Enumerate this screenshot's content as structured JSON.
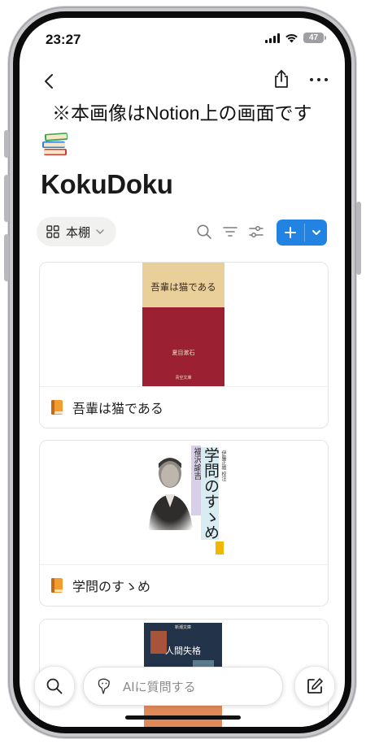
{
  "status_bar": {
    "time": "23:27",
    "battery": "47"
  },
  "page": {
    "note": "※本画像はNotion上の画面です",
    "title": "KokuDoku",
    "icon": "books-emoji"
  },
  "toolbar": {
    "view_label": "本棚",
    "view_icon": "grid-icon",
    "accent": "#2383e2"
  },
  "books": [
    {
      "name": "吾輩は猫である",
      "cover_title": "吾輩は猫である",
      "cover_author": "夏目漱石",
      "cover_publisher": "青空文庫"
    },
    {
      "name": "学問のすゝめ",
      "cover_author": "福沢諭吉",
      "cover_title": "学問のすゝめ",
      "cover_translator": "伊藤正雄 校注"
    },
    {
      "name": "人間失格",
      "cover_title": "人間失格",
      "cover_label": "新潮文庫"
    }
  ],
  "bottom_bar": {
    "ask_placeholder": "AIに質問する"
  }
}
